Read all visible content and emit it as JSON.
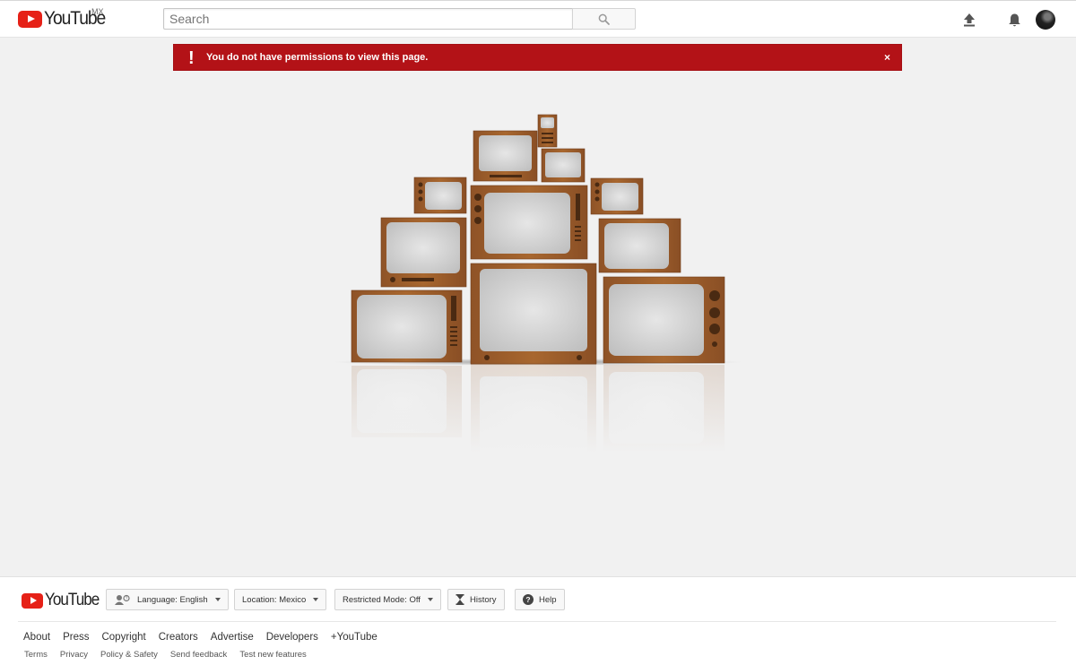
{
  "header": {
    "logo_text": "YouTube",
    "country_code": "MX",
    "search_placeholder": "Search",
    "search_value": ""
  },
  "alert": {
    "icon": "!",
    "message": "You do not have permissions to view this page.",
    "close": "×"
  },
  "footer": {
    "logo_text": "YouTube",
    "language_label": "Language: English",
    "location_label": "Location: Mexico",
    "restricted_mode_label": "Restricted Mode: Off",
    "history_label": "History",
    "help_label": "Help",
    "primary_links": [
      "About",
      "Press",
      "Copyright",
      "Creators",
      "Advertise",
      "Developers",
      "+YouTube"
    ],
    "secondary_links": [
      "Terms",
      "Privacy",
      "Policy & Safety",
      "Send feedback",
      "Test new features"
    ]
  },
  "colors": {
    "brand_red": "#e62117",
    "alert_red": "#b31217",
    "page_background": "#f1f1f1",
    "wood": "#a0622f"
  },
  "icons": {
    "search": "search-icon",
    "upload": "upload-icon",
    "notifications": "bell-icon",
    "language": "people-icon",
    "history": "hourglass-icon",
    "help": "help-icon"
  }
}
